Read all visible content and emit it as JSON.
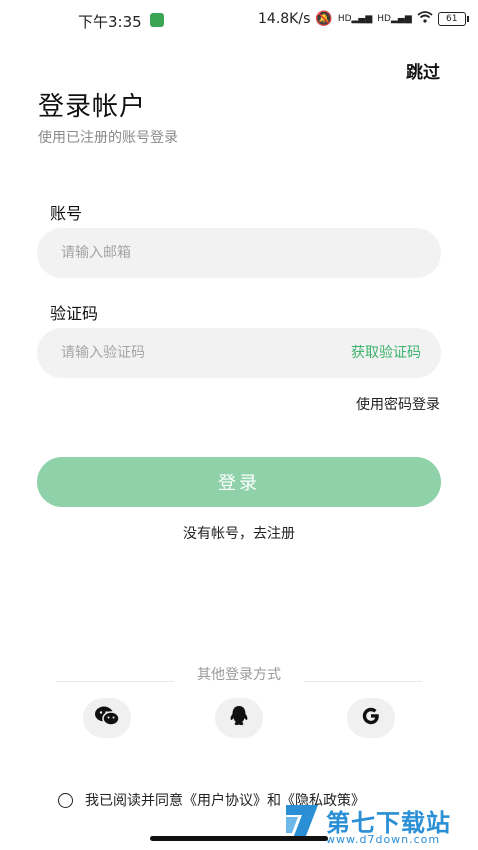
{
  "status_bar": {
    "time": "下午3:35",
    "network_speed": "14.8K/s",
    "signal1": "HD",
    "signal2": "HD",
    "battery": "61"
  },
  "header": {
    "skip": "跳过",
    "title": "登录帐户",
    "subtitle": "使用已注册的账号登录"
  },
  "form": {
    "account_label": "账号",
    "account_placeholder": "请输入邮箱",
    "code_label": "验证码",
    "code_placeholder": "请输入验证码",
    "get_code": "获取验证码",
    "password_login": "使用密码登录",
    "login_button": "登录",
    "register": "没有帐号，去注册"
  },
  "other_login": {
    "label": "其他登录方式",
    "providers": [
      "wechat-icon",
      "qq-icon",
      "google-icon"
    ]
  },
  "agreement": {
    "text": "我已阅读并同意《用户协议》和《隐私政策》"
  },
  "watermark": {
    "name": "第七下载站",
    "url": "www.d7down.com"
  },
  "colors": {
    "accent": "#3bb26c",
    "button": "#8fd1a8",
    "field_bg": "#f2f2f2"
  }
}
